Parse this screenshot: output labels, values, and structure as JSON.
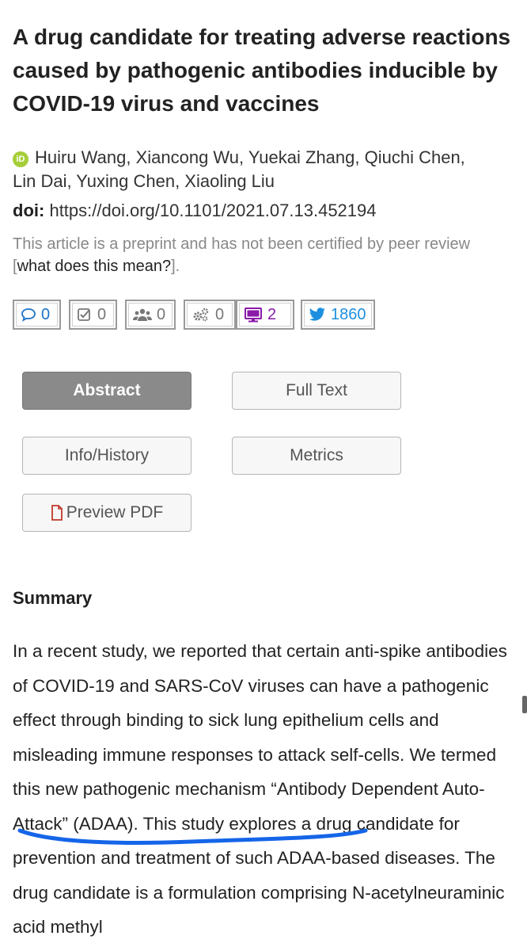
{
  "article": {
    "title": "A drug candidate for treating adverse reactions caused by pathogenic antibodies inducible by COVID-19 virus and vaccines",
    "authors_line1": "Huiru Wang, Xiancong Wu, Yuekai Zhang, Qiuchi Chen,",
    "authors_line2": "Lin Dai, Yuxing Chen, Xiaoling Liu",
    "orcid_icon": "iD",
    "doi_label": "doi:",
    "doi_value": "https://doi.org/10.1101/2021.07.13.452194",
    "notice_text": "This article is a preprint and has not been certified by peer review",
    "notice_link": "what does this mean?",
    "notice_open": "[",
    "notice_close": "]."
  },
  "metrics": [
    {
      "icon": "comment-icon",
      "count": "0",
      "color": "#1a73c8"
    },
    {
      "icon": "checkbox-icon",
      "count": "0",
      "color": "#777777"
    },
    {
      "icon": "group-icon",
      "count": "0",
      "color": "#777777"
    },
    {
      "icon": "gears-icon",
      "count": "0",
      "color": "#777777"
    },
    {
      "icon": "monitor-icon",
      "count": "2",
      "color": "#8a1aa8"
    },
    {
      "icon": "twitter-icon",
      "count": "1860",
      "color": "#1d8fe0"
    }
  ],
  "tabs": {
    "abstract": "Abstract",
    "full_text": "Full Text",
    "info_history": "Info/History",
    "metrics": "Metrics",
    "preview_pdf": "Preview PDF"
  },
  "summary": {
    "heading": "Summary",
    "para_before": "In a recent study, we reported that certain anti-spike antibodies of COVID-19 and SARS-CoV viruses can have a pathogenic effect through binding to sick lung epithelium cells and misleading immune responses to attack self-cells. We termed this new pathogenic mechanism “",
    "highlight": "Antibody Dependent Auto-Attack” (ADAA)",
    "para_after": ". This study explores a drug candidate for prevention and treatment of such ADAA-based diseases. The drug candidate is a formulation comprising N-acetylneuraminic acid methyl"
  },
  "colors": {
    "accent_blue": "#1a73c8",
    "highlight_underline": "#1565e8",
    "active_tab": "#8a8a8a"
  }
}
